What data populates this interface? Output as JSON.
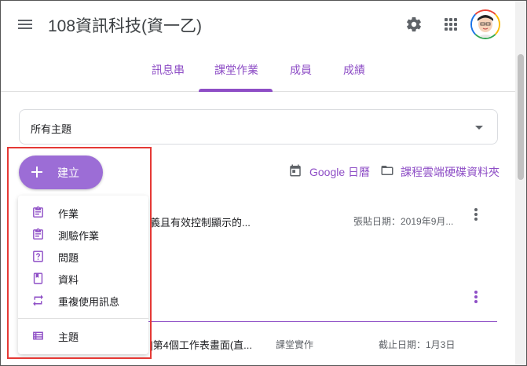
{
  "header": {
    "class_title": "108資訊科技(資一乙)"
  },
  "tabs": [
    {
      "label": "訊息串"
    },
    {
      "label": "課堂作業"
    },
    {
      "label": "成員"
    },
    {
      "label": "成績"
    }
  ],
  "filter": {
    "selected_topic": "所有主題"
  },
  "links": {
    "calendar": "Google 日曆",
    "drive_folder": "課程雲端硬碟資料夾"
  },
  "create_button": {
    "label": "建立"
  },
  "create_menu": {
    "items": [
      {
        "label": "作業",
        "icon": "assignment-icon"
      },
      {
        "label": "測驗作業",
        "icon": "quiz-assignment-icon"
      },
      {
        "label": "問題",
        "icon": "question-icon"
      },
      {
        "label": "資料",
        "icon": "material-icon"
      },
      {
        "label": "重複使用訊息",
        "icon": "reuse-post-icon"
      }
    ],
    "topic_item": {
      "label": "主題",
      "icon": "topic-icon"
    }
  },
  "posts": [
    {
      "title": "義且有效控制顯示的...",
      "date": "張貼日期：2019年9月..."
    },
    {
      "title": "]第4個工作表畫面(直...",
      "topic": "課堂實作",
      "due": "截止日期：1月3日"
    }
  ],
  "colors": {
    "accent": "#8e4ec6",
    "create_button": "#9c6dd6",
    "highlight": "#e53935"
  }
}
